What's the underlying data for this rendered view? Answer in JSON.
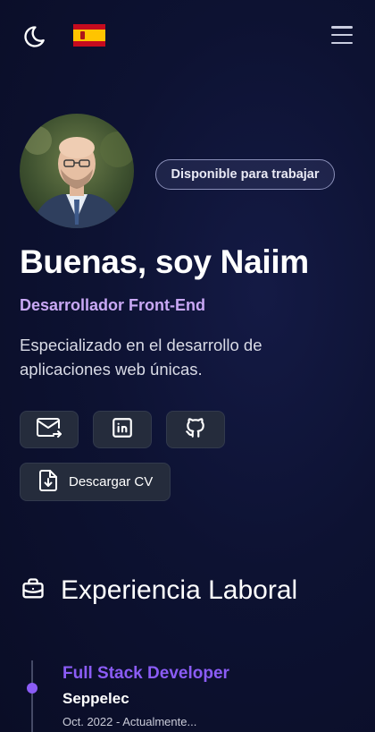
{
  "header": {
    "theme_toggle_icon": "moon-icon",
    "language_flag": "spain-flag-icon",
    "menu_icon": "hamburger-menu-icon"
  },
  "hero": {
    "availability_badge": "Disponible para trabajar",
    "greeting": "Buenas, soy Naiim",
    "role": "Desarrollador Front-End",
    "description": "Especializado en el desarrollo de aplicaciones web únicas."
  },
  "actions": {
    "social": [
      {
        "icon": "mail-icon"
      },
      {
        "icon": "linkedin-icon"
      },
      {
        "icon": "github-icon"
      }
    ],
    "download_cv_label": "Descargar CV"
  },
  "experience": {
    "heading": "Experiencia Laboral",
    "jobs": [
      {
        "title": "Full Stack Developer",
        "company": "Seppelec",
        "period": "Oct. 2022 - Actualmente..."
      }
    ]
  },
  "colors": {
    "accent": "#8b5cf6",
    "role": "#c9a8f5",
    "background": "#0d1232",
    "button": "#252c3c"
  }
}
